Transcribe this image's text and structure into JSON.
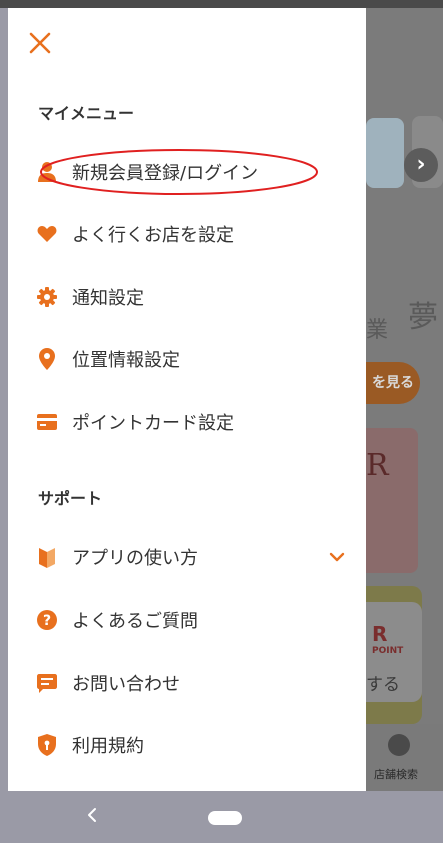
{
  "colors": {
    "accent": "#e8701e",
    "highlight": "#e02020",
    "text": "#333333"
  },
  "drawer": {
    "close_icon": "close-icon",
    "sections": [
      {
        "heading": "マイメニュー",
        "items": [
          {
            "label": "新規会員登録/ログイン",
            "icon": "person-icon"
          },
          {
            "label": "よく行くお店を設定",
            "icon": "heart-icon"
          },
          {
            "label": "通知設定",
            "icon": "gear-icon"
          },
          {
            "label": "位置情報設定",
            "icon": "location-pin-icon"
          },
          {
            "label": "ポイントカード設定",
            "icon": "card-icon"
          }
        ]
      },
      {
        "heading": "サポート",
        "items": [
          {
            "label": "アプリの使い方",
            "icon": "guide-icon",
            "expandable": true
          },
          {
            "label": "よくあるご質問",
            "icon": "question-icon"
          },
          {
            "label": "お問い合わせ",
            "icon": "chat-icon"
          },
          {
            "label": "利用規約",
            "icon": "shield-icon"
          }
        ]
      }
    ]
  },
  "background": {
    "see_more": "を見る",
    "banner_text": "R",
    "kanji_left": "業",
    "kanji_right": "夢",
    "card_logo": "R",
    "card_logo_sub": "POINT",
    "card_text": "する",
    "tab_label": "店舗検索"
  }
}
